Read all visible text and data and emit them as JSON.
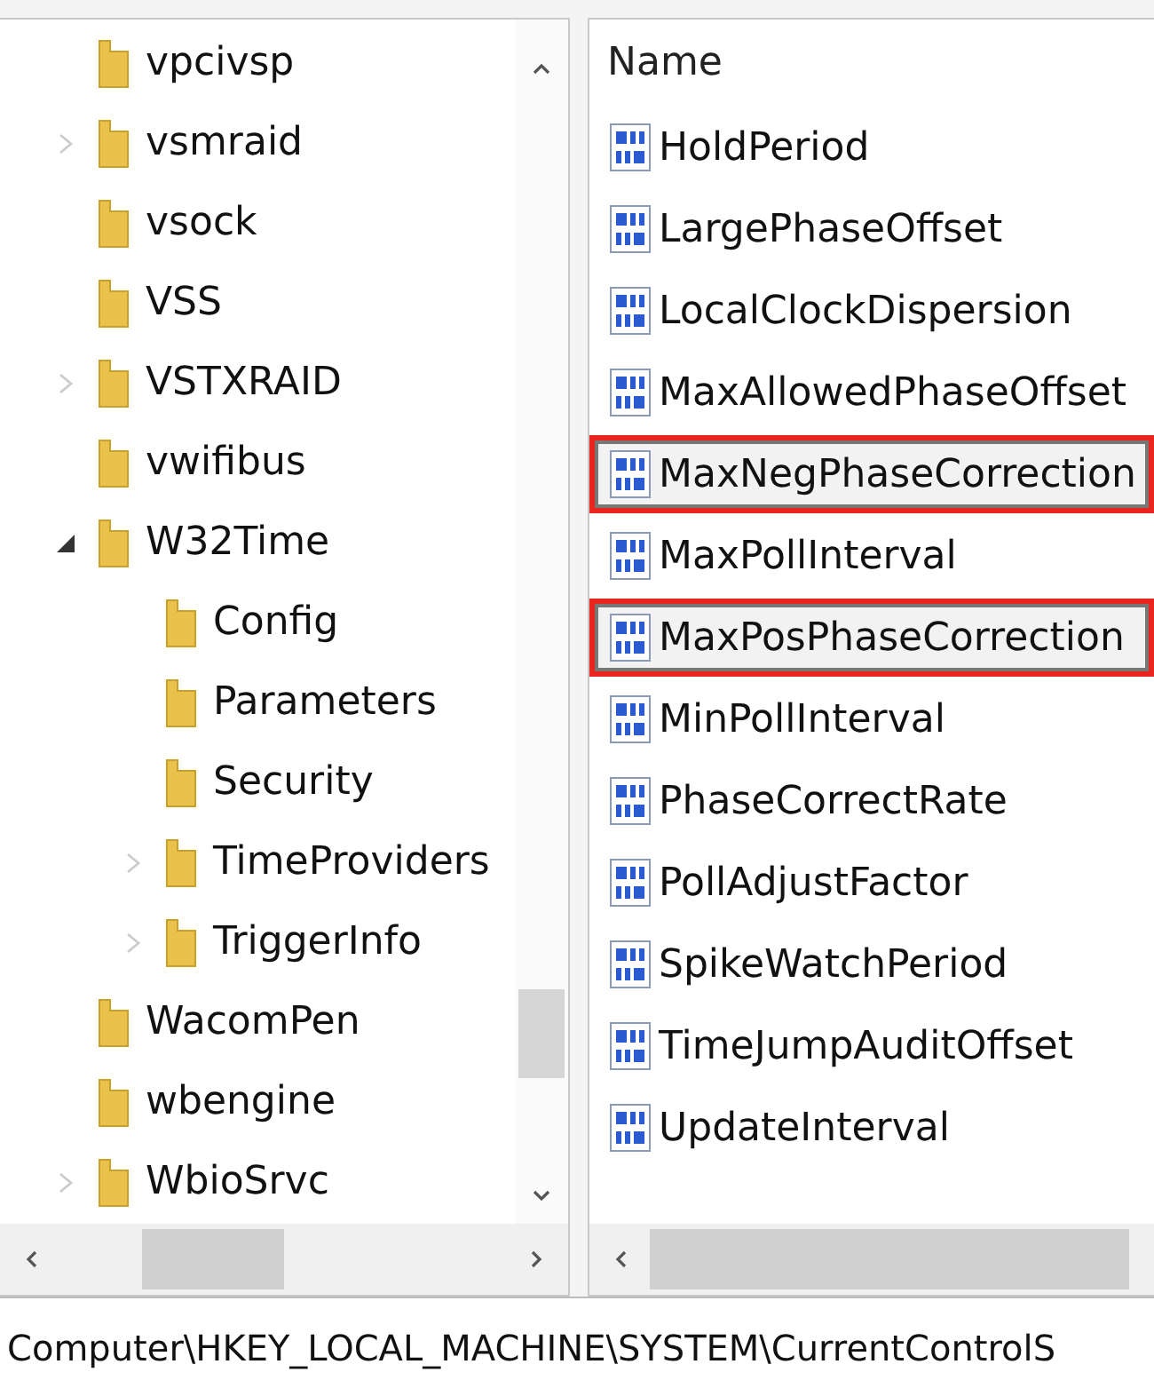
{
  "tree": [
    {
      "label": "vpcivsp"
    },
    {
      "label": "vsmraid",
      "expanded": false
    },
    {
      "label": "vsock"
    },
    {
      "label": "VSS"
    },
    {
      "label": "VSTXRAID",
      "expanded": false
    },
    {
      "label": "vwifibus"
    },
    {
      "label": "W32Time",
      "expanded": true,
      "children": [
        {
          "label": "Config"
        },
        {
          "label": "Parameters"
        },
        {
          "label": "Security"
        },
        {
          "label": "TimeProviders",
          "expanded": false
        },
        {
          "label": "TriggerInfo",
          "expanded": false
        }
      ]
    },
    {
      "label": "WacomPen"
    },
    {
      "label": "wbengine"
    },
    {
      "label": "WbioSrvc",
      "expanded": false
    }
  ],
  "values_list": {
    "column_header": "Name",
    "rows": [
      {
        "name": "HoldPeriod",
        "highlighted": false
      },
      {
        "name": "LargePhaseOffset",
        "highlighted": false
      },
      {
        "name": "LocalClockDispersion",
        "highlighted": false
      },
      {
        "name": "MaxAllowedPhaseOffset",
        "highlighted": false
      },
      {
        "name": "MaxNegPhaseCorrection",
        "highlighted": true
      },
      {
        "name": "MaxPollInterval",
        "highlighted": false
      },
      {
        "name": "MaxPosPhaseCorrection",
        "highlighted": true
      },
      {
        "name": "MinPollInterval",
        "highlighted": false
      },
      {
        "name": "PhaseCorrectRate",
        "highlighted": false
      },
      {
        "name": "PollAdjustFactor",
        "highlighted": false
      },
      {
        "name": "SpikeWatchPeriod",
        "highlighted": false
      },
      {
        "name": "TimeJumpAuditOffset",
        "highlighted": false
      },
      {
        "name": "UpdateInterval",
        "highlighted": false
      }
    ]
  },
  "status_bar": "Computer\\HKEY_LOCAL_MACHINE\\SYSTEM\\CurrentControlS"
}
